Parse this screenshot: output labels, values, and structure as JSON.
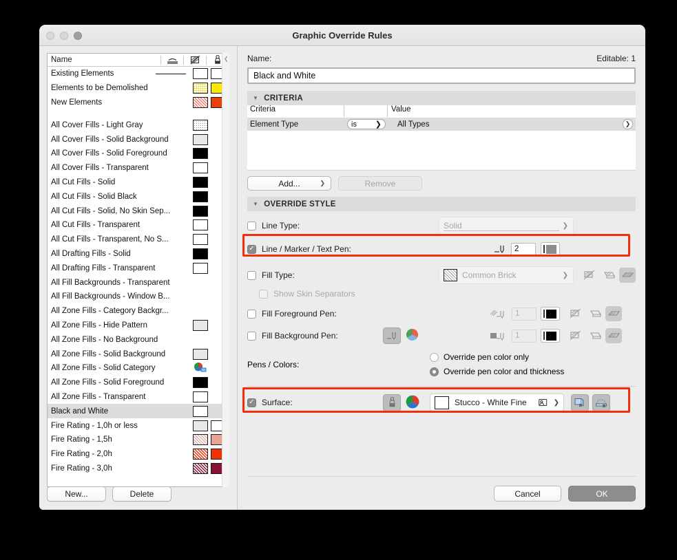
{
  "window": {
    "title": "Graphic Override Rules",
    "traffic_lights": [
      "close-button",
      "minimize-button",
      "zoom-button"
    ]
  },
  "list": {
    "header": {
      "name_column": "Name",
      "icons": [
        "line-type-icon",
        "fill-icon",
        "surface-brush-icon"
      ]
    },
    "items": [
      {
        "label": "Existing Elements",
        "line": true,
        "swatches": [
          "#ffffff",
          "#ffffff"
        ]
      },
      {
        "label": "Elements to be Demolished",
        "swatches": [
          "dot-yellow",
          "#ffe800"
        ]
      },
      {
        "label": "New Elements",
        "swatches": [
          "hatch-red",
          "#e8410a"
        ]
      },
      {
        "gap": true
      },
      {
        "label": "All Cover Fills - Light Gray",
        "swatches": [
          "dot-gray"
        ]
      },
      {
        "label": "All Cover Fills - Solid Background",
        "swatches": [
          "#e8e8e8"
        ]
      },
      {
        "label": "All Cover Fills - Solid Foreground",
        "swatches": [
          "#000000"
        ]
      },
      {
        "label": "All Cover Fills - Transparent",
        "swatches": [
          "#ffffff"
        ]
      },
      {
        "label": "All Cut Fills - Solid",
        "swatches": [
          "#000000"
        ]
      },
      {
        "label": "All Cut Fills - Solid Black",
        "swatches": [
          "#000000"
        ]
      },
      {
        "label": "All Cut Fills - Solid, No Skin Sep...",
        "swatches": [
          "#000000"
        ]
      },
      {
        "label": "All Cut Fills - Transparent",
        "swatches": [
          "#ffffff"
        ]
      },
      {
        "label": "All Cut Fills - Transparent, No S...",
        "swatches": [
          "#ffffff"
        ]
      },
      {
        "label": "All Drafting Fills - Solid",
        "swatches": [
          "#000000"
        ]
      },
      {
        "label": "All Drafting Fills - Transparent",
        "swatches": [
          "#ffffff"
        ]
      },
      {
        "label": "All Fill Backgrounds - Transparent",
        "swatches": []
      },
      {
        "label": "All Fill Backgrounds - Window B...",
        "swatches": []
      },
      {
        "label": "All Zone Fills - Category Backgr...",
        "swatches": []
      },
      {
        "label": "All Zone Fills - Hide Pattern",
        "swatches": [
          "#e8e8e8"
        ]
      },
      {
        "label": "All Zone Fills - No Background",
        "swatches": []
      },
      {
        "label": "All Zone Fills - Solid Background",
        "swatches": [
          "#e8e8e8"
        ]
      },
      {
        "label": "All Zone Fills - Solid Category",
        "swatches": [
          "category-pie"
        ]
      },
      {
        "label": "All Zone Fills - Solid Foreground",
        "swatches": [
          "#000000"
        ]
      },
      {
        "label": "All Zone Fills - Transparent",
        "swatches": [
          "#ffffff"
        ]
      },
      {
        "label": "Black and White",
        "selected": true,
        "swatches": [
          "#ffffff"
        ]
      },
      {
        "label": "Fire Rating - 1,0h or less",
        "swatches": [
          "#e8e8e8",
          "#ffffff"
        ]
      },
      {
        "label": "Fire Rating - 1,5h",
        "swatches": [
          "hatch-pink",
          "#e8a593"
        ]
      },
      {
        "label": "Fire Rating - 2,0h",
        "swatches": [
          "hatch-orange",
          "#ec3404"
        ]
      },
      {
        "label": "Fire Rating - 3,0h",
        "swatches": [
          "hatch-darkred",
          "#8c1432"
        ]
      }
    ],
    "new_button": "New...",
    "delete_button": "Delete"
  },
  "detail": {
    "name_label": "Name:",
    "editable_label": "Editable: 1",
    "name_value": "Black and White",
    "criteria_section": {
      "title": "CRITERIA",
      "columns": [
        "Criteria",
        "",
        "Value"
      ],
      "rows": [
        {
          "criteria": "Element Type",
          "operator": "is",
          "value": "All Types"
        }
      ],
      "add_button": "Add...",
      "remove_button": "Remove"
    },
    "override_section": {
      "title": "OVERRIDE STYLE",
      "line_type": {
        "label": "Line Type:",
        "checked": false,
        "value": "Solid"
      },
      "line_pen": {
        "label": "Line / Marker / Text Pen:",
        "checked": true,
        "pen": "2",
        "highlighted": true
      },
      "fill_type": {
        "label": "Fill Type:",
        "checked": false,
        "value": "Common Brick"
      },
      "skin_separators": {
        "label": "Show Skin Separators",
        "checked": false
      },
      "fill_fg_pen": {
        "label": "Fill Foreground Pen:",
        "checked": false,
        "pen": "1"
      },
      "fill_bg_pen": {
        "label": "Fill Background Pen:",
        "checked": false,
        "pen": "1"
      },
      "pens_colors": {
        "label": "Pens / Colors:",
        "options": [
          "Override pen color only",
          "Override pen color and thickness"
        ],
        "selected_index": 1
      },
      "surface": {
        "label": "Surface:",
        "checked": true,
        "value": "Stucco - White Fine",
        "highlighted": true
      }
    }
  },
  "footer": {
    "cancel": "Cancel",
    "ok": "OK"
  },
  "colors": {
    "highlight": "#f42d0c",
    "selection": "#dcdcdc",
    "accent_ok": "#8d8d8d"
  }
}
